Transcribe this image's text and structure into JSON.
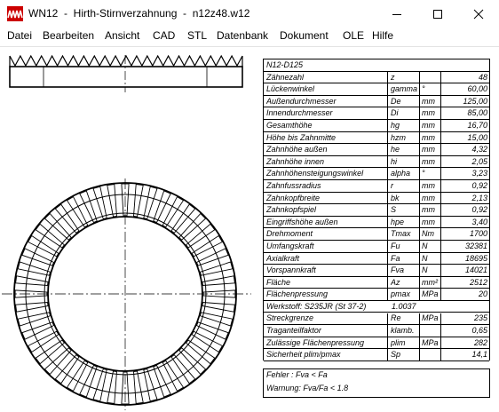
{
  "window": {
    "title": "WN12  -  Hirth-Stirnverzahnung  -  n12z48.w12",
    "minimize_glyph": "—",
    "close_glyph": "✕"
  },
  "menu": [
    {
      "label": "Datei"
    },
    {
      "label": "Bearbeiten"
    },
    {
      "label": "Ansicht"
    },
    {
      "label": "CAD"
    },
    {
      "label": "STL"
    },
    {
      "label": "Datenbank"
    },
    {
      "label": "Dokument"
    },
    {
      "label": "OLE"
    },
    {
      "label": "Hilfe"
    }
  ],
  "drawing": {
    "tooth_count": 48,
    "line_color": "#000000",
    "icon_color": "#cc0000"
  },
  "table": {
    "header": "N12-D125",
    "rows": [
      {
        "name": "Zähnezahl",
        "sym": "z",
        "unit": "",
        "val": "48"
      },
      {
        "name": "Lückenwinkel",
        "sym": "gamma",
        "unit": "°",
        "val": "60,00"
      },
      {
        "name": "Außendurchmesser",
        "sym": "De",
        "unit": "mm",
        "val": "125,00"
      },
      {
        "name": "Innendurchmesser",
        "sym": "Di",
        "unit": "mm",
        "val": "85,00"
      },
      {
        "name": "Gesamthöhe",
        "sym": "hg",
        "unit": "mm",
        "val": "16,70"
      },
      {
        "name": "Höhe bis Zahnmitte",
        "sym": "hzm",
        "unit": "mm",
        "val": "15,00"
      },
      {
        "name": "Zahnhöhe außen",
        "sym": "he",
        "unit": "mm",
        "val": "4,32"
      },
      {
        "name": "Zahnhöhe innen",
        "sym": "hi",
        "unit": "mm",
        "val": "2,05"
      },
      {
        "name": "Zahnhöhensteigungswinkel",
        "sym": "alpha",
        "unit": "°",
        "val": "3,23"
      },
      {
        "name": "Zahnfussradius",
        "sym": "r",
        "unit": "mm",
        "val": "0,92"
      },
      {
        "name": "Zahnkopfbreite",
        "sym": "bk",
        "unit": "mm",
        "val": "2,13"
      },
      {
        "name": "Zahnkopfspiel",
        "sym": "S",
        "unit": "mm",
        "val": "0,92"
      },
      {
        "name": "Eingriffshöhe außen",
        "sym": "hpe",
        "unit": "mm",
        "val": "3,40"
      },
      {
        "name": "Drehmoment",
        "sym": "Tmax",
        "unit": "Nm",
        "val": "1700"
      },
      {
        "name": "Umfangskraft",
        "sym": "Fu",
        "unit": "N",
        "val": "32381"
      },
      {
        "name": "Axialkraft",
        "sym": "Fa",
        "unit": "N",
        "val": "18695"
      },
      {
        "name": "Vorspannkraft",
        "sym": "Fva",
        "unit": "N",
        "val": "14021"
      },
      {
        "name": "Fläche",
        "sym": "Az",
        "unit": "mm²",
        "val": "2512"
      },
      {
        "name": "Flächenpressung",
        "sym": "pmax",
        "unit": "MPa",
        "val": "20"
      }
    ],
    "material": {
      "label": "Werkstoff:  S235JR (St 37-2)",
      "value": "1.0037"
    },
    "rows2": [
      {
        "name": "Streckgrenze",
        "sym": "Re",
        "unit": "MPa",
        "val": "235"
      },
      {
        "name": "Traganteilfaktor",
        "sym": "klamb.",
        "unit": "",
        "val": "0,65"
      },
      {
        "name": "Zulässige Flächenpressung",
        "sym": "plim",
        "unit": "MPa",
        "val": "282"
      },
      {
        "name": "Sicherheit plim/pmax",
        "sym": "Sp",
        "unit": "",
        "val": "14,1"
      }
    ]
  },
  "messages": {
    "error": "Fehler : Fva < Fa",
    "warning": "Warnung: Fva/Fa < 1.8"
  }
}
